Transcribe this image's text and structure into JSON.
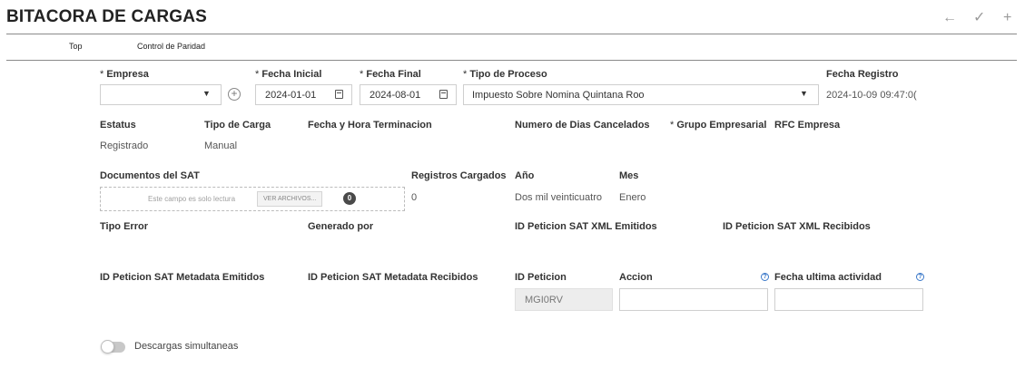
{
  "header": {
    "title": "BITACORA DE CARGAS",
    "back_icon": "←",
    "check_icon": "✓",
    "add_icon": "+"
  },
  "tabs": [
    {
      "label": "Top"
    },
    {
      "label": "Control de Paridad"
    }
  ],
  "form": {
    "empresa": {
      "req": "*",
      "label": "Empresa",
      "value": ""
    },
    "fecha_inicial": {
      "req": "*",
      "label": "Fecha Inicial",
      "value": "2024-01-01"
    },
    "fecha_final": {
      "req": "*",
      "label": "Fecha Final",
      "value": "2024-08-01"
    },
    "tipo_proceso": {
      "req": "*",
      "label": "Tipo de Proceso",
      "value": "Impuesto Sobre Nomina Quintana Roo"
    },
    "fecha_registro": {
      "label": "Fecha Registro",
      "value": "2024-10-09 09:47:0("
    },
    "estatus": {
      "label": "Estatus",
      "value": "Registrado"
    },
    "tipo_carga": {
      "label": "Tipo de Carga",
      "value": "Manual"
    },
    "fecha_terminacion": {
      "label": "Fecha y Hora Terminacion",
      "value": ""
    },
    "dias_cancelados": {
      "label": "Numero de Dias Cancelados",
      "value": ""
    },
    "grupo_empresarial": {
      "req": "*",
      "label": "Grupo Empresarial",
      "value": ""
    },
    "rfc_empresa": {
      "label": "RFC Empresa",
      "value": ""
    },
    "documentos_sat": {
      "label": "Documentos del SAT",
      "readonly_text": "Este campo es solo lectura",
      "button_label": "VER ARCHIVOS...",
      "count": "0"
    },
    "registros_cargados": {
      "label": "Registros Cargados",
      "value": "0"
    },
    "anio": {
      "label": "Año",
      "value": "Dos mil veinticuatro"
    },
    "mes": {
      "label": "Mes",
      "value": "Enero"
    },
    "tipo_error": {
      "label": "Tipo Error"
    },
    "generado_por": {
      "label": "Generado por"
    },
    "id_sat_xml_emitidos": {
      "label": "ID Peticion SAT XML Emitidos"
    },
    "id_sat_xml_recibidos": {
      "label": "ID Peticion SAT XML Recibidos"
    },
    "id_sat_meta_emitidos": {
      "label": "ID Peticion SAT Metadata Emitidos"
    },
    "id_sat_meta_recibidos": {
      "label": "ID Peticion SAT Metadata Recibidos"
    },
    "id_peticion": {
      "label": "ID Peticion",
      "value": "MGI0RV"
    },
    "accion": {
      "label": "Accion",
      "value": ""
    },
    "fecha_ultima": {
      "label": "Fecha ultima actividad",
      "value": ""
    },
    "descargas": {
      "label": "Descargas simultaneas"
    }
  }
}
